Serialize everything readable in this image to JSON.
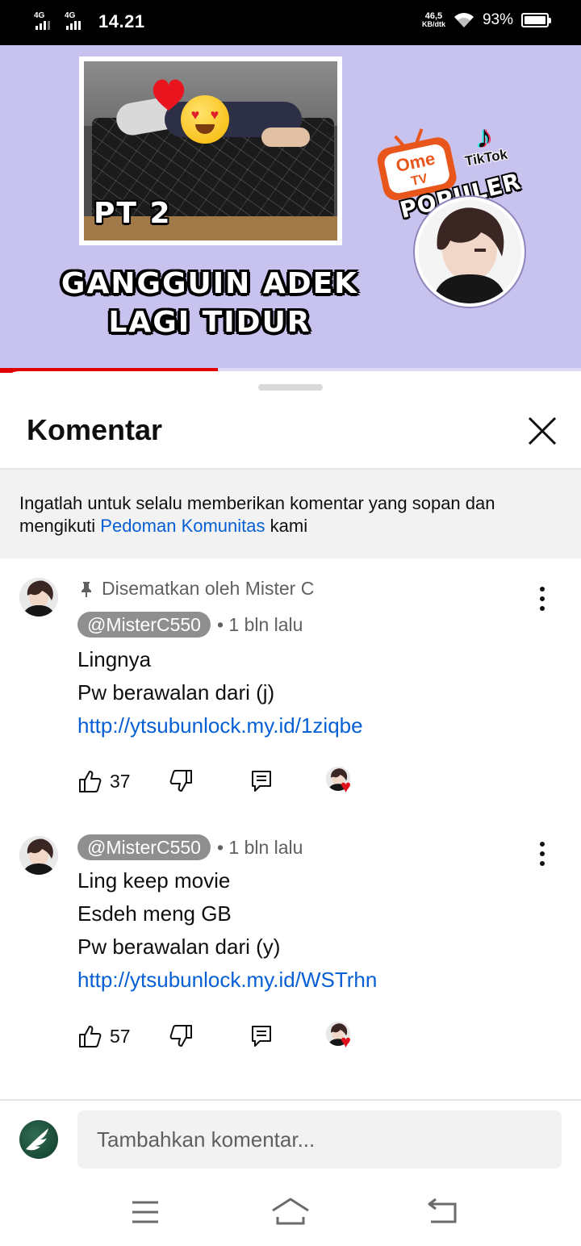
{
  "status_bar": {
    "signal_1": "4G",
    "signal_2": "4G",
    "time": "14.21",
    "net_speed_value": "46,5",
    "net_speed_unit": "KB/dtk",
    "battery": "93%"
  },
  "video": {
    "thumb_badge": "PT 2",
    "title_line_1": "GANGGUIN ADEK",
    "title_line_2": "LAGI TIDUR",
    "ometv_top": "Ome",
    "ometv_bottom": "TV",
    "tiktok_label": "TikTok",
    "populer": "POPULER",
    "progress_fraction": 0.375
  },
  "sheet": {
    "title": "Komentar",
    "guideline_text": "Ingatlah untuk selalu memberikan komentar yang sopan dan mengikuti ",
    "guideline_link": "Pedoman Komunitas",
    "guideline_suffix": " kami"
  },
  "comments": [
    {
      "pinned_label": "Disematkan oleh Mister C",
      "author": "@MisterC550",
      "time": "• 1 bln lalu",
      "lines": [
        "Lingnya",
        "Pw berawalan dari (j)"
      ],
      "link": "http://ytsubunlock.my.id/1ziqbe",
      "likes": "37"
    },
    {
      "author": "@MisterC550",
      "time": "• 1 bln lalu",
      "lines": [
        "Ling keep movie",
        "Esdeh meng GB",
        "Pw berawalan dari (y)"
      ],
      "link": "http://ytsubunlock.my.id/WSTrhn",
      "likes": "57"
    }
  ],
  "composer": {
    "placeholder": "Tambahkan komentar..."
  },
  "colors": {
    "link": "#065fd4",
    "progress": "#e00000",
    "video_bg": "#c8c3ee",
    "heart": "#e0101c"
  },
  "icons": {
    "close": "close-icon",
    "pin": "pin-icon",
    "more": "more-vert-icon",
    "like": "thumbs-up-icon",
    "dislike": "thumbs-down-icon",
    "reply": "reply-icon",
    "creator_heart": "creator-heart-icon",
    "nav_menu": "menu-icon",
    "nav_home": "home-icon",
    "nav_back": "back-icon"
  }
}
